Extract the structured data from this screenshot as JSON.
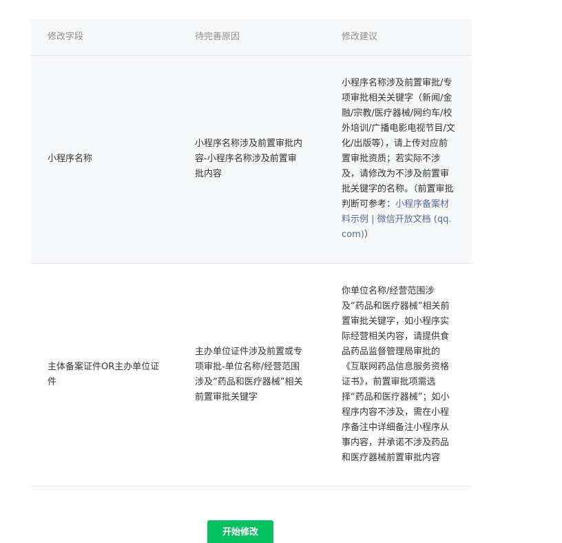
{
  "table": {
    "headers": [
      "修改字段",
      "待完善原因",
      "修改建议"
    ],
    "rows": [
      {
        "field": "小程序名称",
        "reason": "小程序名称涉及前置审批内容-小程序名称涉及前置审批内容",
        "suggestion_text": "小程序名称涉及前置审批/专项审批相关关键字（新闻/金融/宗教/医疗器械/网约车/校外培训/广播电影电视节目/文化/出版等），请上传对应前置审批资质；若实际不涉及，请修改为不涉及前置审批关键字的名称。（前置审批判断可参考：",
        "suggestion_link1": "小程序备案材料示例",
        "suggestion_separator": " | ",
        "suggestion_link2": "微信开放文档 (qq.com)",
        "suggestion_end": "）"
      },
      {
        "field": "主体备案证件OR主办单位证件",
        "reason": "主办单位证件涉及前置或专项审批-单位名称/经营范围涉及“药品和医疗器械”相关前置审批关键字",
        "suggestion_text": "你单位名称/经营范围涉及“药品和医疗器械”相关前置审批关键字，如小程序实际经营相关内容，请提供食品药品监督管理局审批的《互联网药品信息服务资格证书》，前置审批项需选择“药品和医疗器械”；如小程序内容不涉及，需在小程序备注中详细备注小程序从事内容，并承诺不涉及药品和医疗器械前置审批内容"
      }
    ]
  },
  "actions": {
    "start_edit_label": "开始修改"
  },
  "colors": {
    "primary_button": "#07c160",
    "link": "#576b95",
    "header_bg": "#f6f8f9"
  }
}
